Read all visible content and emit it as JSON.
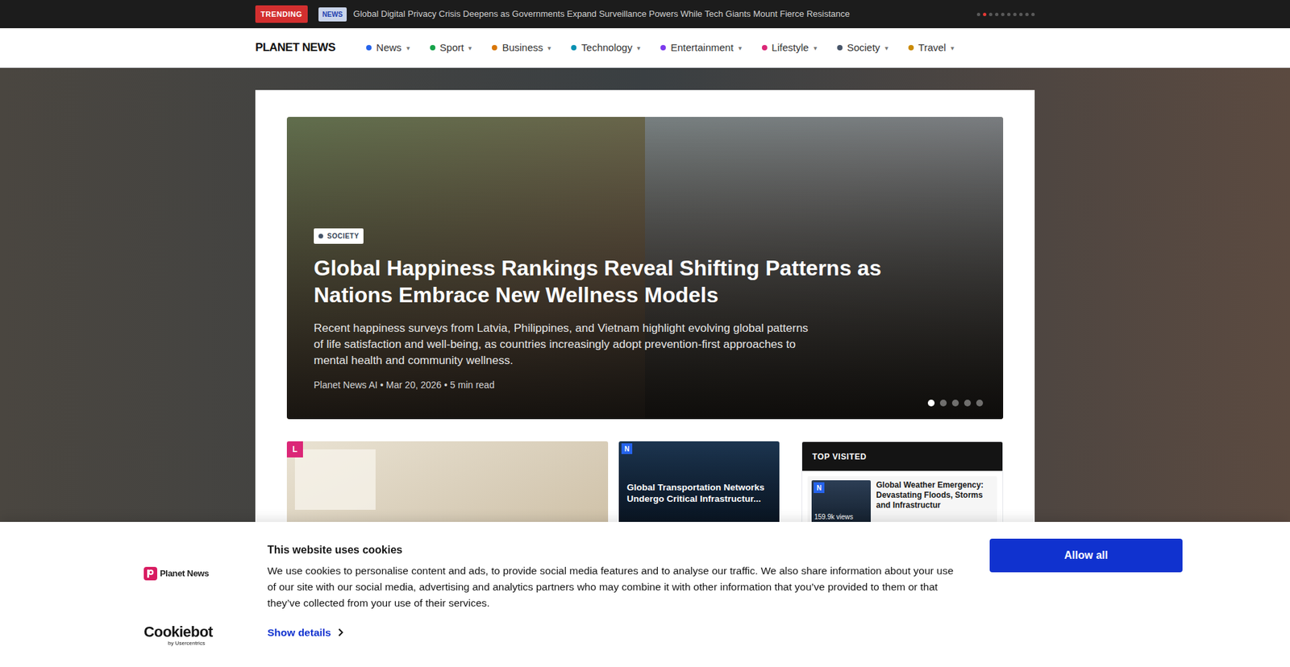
{
  "trending": {
    "label": "TRENDING",
    "category": "NEWS",
    "headline": "Global Digital Privacy Crisis Deepens as Governments Expand Surveillance Powers While Tech Giants Mount Fierce Resistance",
    "dots": [
      {
        "selected": false
      },
      {
        "selected": true
      },
      {
        "selected": false
      },
      {
        "selected": false
      },
      {
        "selected": false
      },
      {
        "selected": false
      },
      {
        "selected": false
      },
      {
        "selected": false
      },
      {
        "selected": false
      },
      {
        "selected": false
      }
    ]
  },
  "nav": {
    "logo": "PLANET NEWS",
    "items": [
      {
        "label": "News",
        "color": "#2563eb",
        "arrow": "▾"
      },
      {
        "label": "Sport",
        "color": "#16a34a",
        "arrow": "▾"
      },
      {
        "label": "Business",
        "color": "#d97706",
        "arrow": "▾"
      },
      {
        "label": "Technology",
        "color": "#0891b2",
        "arrow": "▾"
      },
      {
        "label": "Entertainment",
        "color": "#7c3aed",
        "arrow": "▾"
      },
      {
        "label": "Lifestyle",
        "color": "#db2777",
        "arrow": "▾"
      },
      {
        "label": "Society",
        "color": "#475569",
        "arrow": "▾"
      },
      {
        "label": "Travel",
        "color": "#ca8a04",
        "arrow": "▾"
      }
    ]
  },
  "hero": {
    "category": "SOCIETY",
    "category_color": "#475569",
    "title": "Global Happiness Rankings Reveal Shifting Patterns as Nations Embrace New Wellness Models",
    "summary": "Recent happiness surveys from Latvia, Philippines, and Vietnam highlight evolving global patterns of life satisfaction and well-being, as countries increasingly adopt prevention-first approaches to mental health and community wellness.",
    "meta": "Planet News AI • Mar 20, 2026 • 5 min read",
    "dots": [
      {
        "selected": true
      },
      {
        "selected": false
      },
      {
        "selected": false
      },
      {
        "selected": false
      },
      {
        "selected": false
      }
    ]
  },
  "cards": [
    {
      "kind": "image",
      "badge": "L",
      "color": "#db2777"
    },
    {
      "kind": "overlay",
      "badge": "N",
      "color": "#2563eb",
      "title": "Global Transportation Networks Undergo Critical Infrastructur..."
    }
  ],
  "top_visited": {
    "title": "TOP VISITED",
    "items": [
      {
        "badge": "N",
        "color": "#2563eb",
        "views": "159.9k views",
        "title": "Global Weather Emergency: Devastating Floods, Storms and Infrastructur"
      }
    ]
  },
  "cookie": {
    "brand": "Planet News",
    "title": "This website uses cookies",
    "text": "We use cookies to personalise content and ads, to provide social media features and to analyse our traffic. We also share information about your use of our site with our social media, advertising and analytics partners who may combine it with other information that you’ve provided to them or that they’ve collected from your use of their services.",
    "details": "Show details",
    "provider": "Cookiebot",
    "provider_sub": "by Usercentrics",
    "button": "Allow all"
  }
}
